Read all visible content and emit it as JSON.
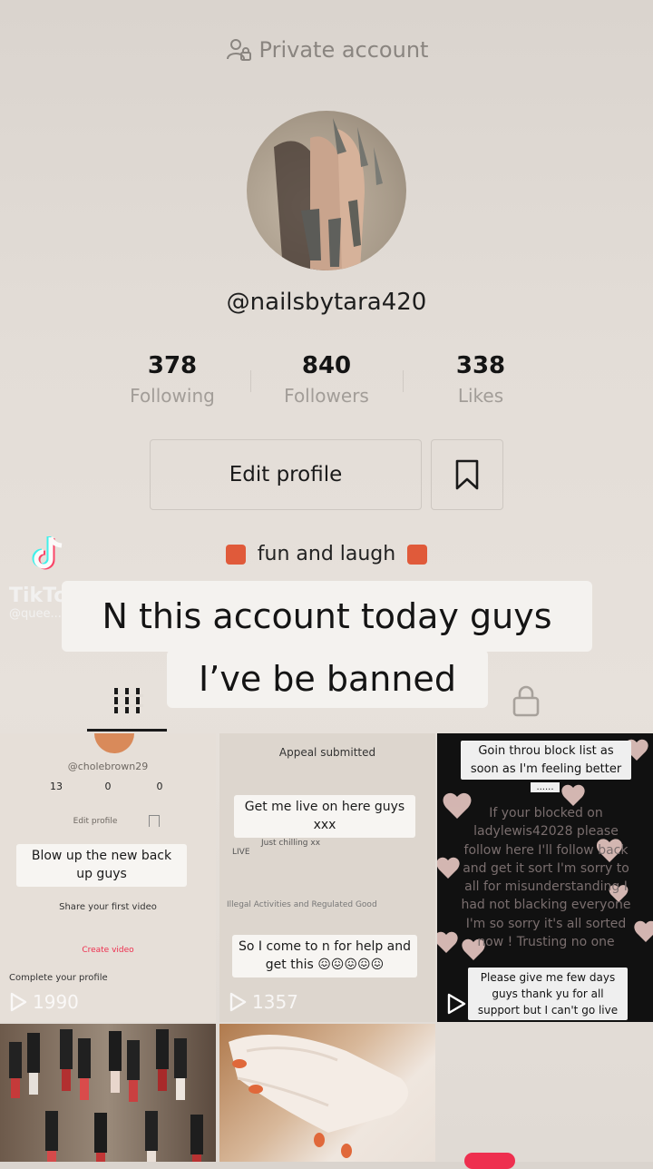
{
  "header": {
    "private_label": "Private account"
  },
  "profile": {
    "username": "@nailsbytara420",
    "stats": [
      {
        "value": "378",
        "label": "Following"
      },
      {
        "value": "840",
        "label": "Followers"
      },
      {
        "value": "338",
        "label": "Likes"
      }
    ],
    "edit_label": "Edit profile",
    "bio_line1": "fun and laugh"
  },
  "watermark": {
    "brand": "TikTok",
    "handle": "@quee...lam_3172"
  },
  "captions": {
    "line1": "N this account today guys",
    "line2": "I’ve be banned"
  },
  "grid": {
    "cell1": {
      "handle": "@cholebrown29",
      "stats": [
        "13",
        "0",
        "0"
      ],
      "edit": "Edit profile",
      "overlay": "Blow up the new back up guys",
      "share": "Share your first video",
      "create": "Create video",
      "complete": "Complete your profile",
      "views": "1990"
    },
    "cell2": {
      "title": "Appeal submitted",
      "overlay1": "Get me live on here guys xxx",
      "chill": "Just chilling xx",
      "live": "LIVE",
      "illegal": "Illegal Activities and Regulated Good",
      "overlay2": "So I come to n for help and get this 😖😖😖😖😖",
      "views": "1357"
    },
    "cell3": {
      "overlay_top": "Goin throu block list as soon as I'm feeling better",
      "dots": "......",
      "body": "If your blocked on ladylewis42028 please follow here I'll follow back and get it sort I'm sorry to all for misunderstanding I had not blacking everyone I'm so sorry it's all sorted now ! Trusting no one",
      "overlay_bottom": "Please give me few days guys thank yu for all support but I can't go live"
    }
  },
  "colors": {
    "accent": "#ee2f4f",
    "caption_bg": "#f4f2ef",
    "tab_active": "#1a1a1a"
  }
}
